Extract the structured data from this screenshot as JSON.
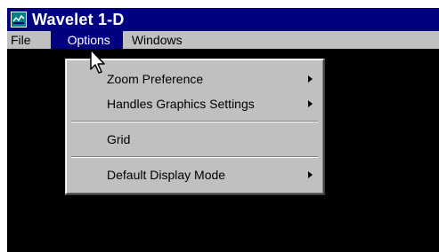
{
  "window": {
    "title": "Wavelet 1-D",
    "icon": "app-icon"
  },
  "menubar": {
    "items": [
      {
        "label": "File"
      },
      {
        "label": "Options",
        "active": true
      },
      {
        "label": "Windows"
      }
    ]
  },
  "options_menu": {
    "items": [
      {
        "label": "Zoom Preference",
        "submenu": true
      },
      {
        "label": "Handles Graphics Settings",
        "submenu": true
      },
      {
        "label": "Grid",
        "submenu": false
      },
      {
        "label": "Default Display Mode",
        "submenu": true
      }
    ]
  },
  "colors": {
    "titlebar": "#000080",
    "menu_bg": "#c0c0c0",
    "highlight": "#000080",
    "canvas": "#000000"
  }
}
